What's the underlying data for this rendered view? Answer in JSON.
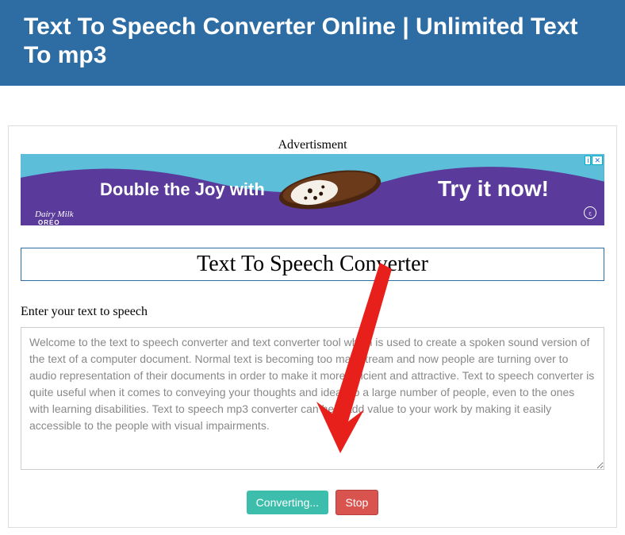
{
  "header": {
    "title": "Text To Speech Converter Online | Unlimited Text To mp3"
  },
  "ad": {
    "label": "Advertisment",
    "text_left": "Double the Joy with",
    "text_right": "Try it now!",
    "brand1": "Dairy Milk",
    "brand2": "OREO",
    "badge1": "i",
    "badge2": "✕"
  },
  "section": {
    "title": "Text To Speech Converter"
  },
  "form": {
    "label": "Enter your text to speech",
    "textarea_value": "Welcome to the text to speech converter and text converter tool which is used to create a spoken sound version of the text of a computer document. Normal text is becoming too mainstream and now people are turning over to audio representation of their documents in order to make it more efficient and attractive. Text to speech converter is quite useful when it comes to conveying your thoughts and ideas to a large number of people, even to the ones with learning disabilities. Text to speech mp3 converter can help add value to your work by making it easily accessible to the people with visual impairments."
  },
  "buttons": {
    "convert": "Converting...",
    "stop": "Stop"
  }
}
